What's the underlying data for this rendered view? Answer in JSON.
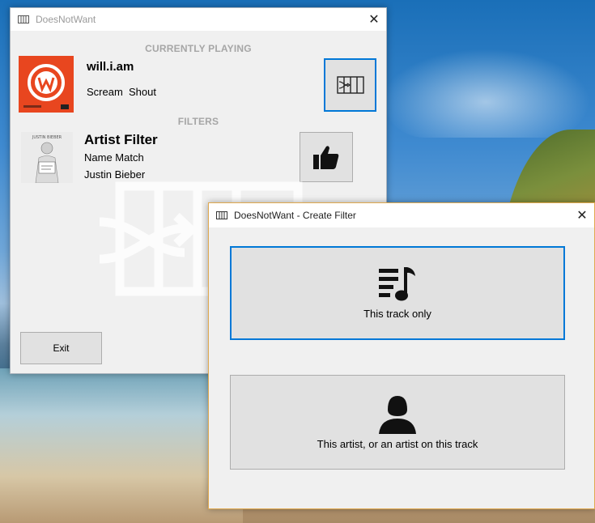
{
  "main_window": {
    "title": "DoesNotWant",
    "close_glyph": "✕",
    "currently_playing_header": "CURRENTLY PLAYING",
    "now_playing": {
      "artist": "will.i.am",
      "track": "Scream  Shout",
      "cover_icon": "will-i-am-logo"
    },
    "create_filter_button_icon": "filter-icon",
    "filters_header": "FILTERS",
    "filter": {
      "title": "Artist Filter",
      "match_type": "Name Match",
      "artist": "Justin Bieber"
    },
    "like_button_icon": "thumbs-up-icon",
    "exit_label": "Exit"
  },
  "dialog": {
    "title": "DoesNotWant - Create Filter",
    "close_glyph": "✕",
    "track_option": {
      "label": "This track only",
      "icon": "playlist-music-icon"
    },
    "artist_option": {
      "label": "This artist, or an artist on this track",
      "icon": "person-icon"
    }
  },
  "colors": {
    "accent": "#0078d7",
    "cover_orange": "#e8461f",
    "dialog_border": "#e0a94f"
  }
}
